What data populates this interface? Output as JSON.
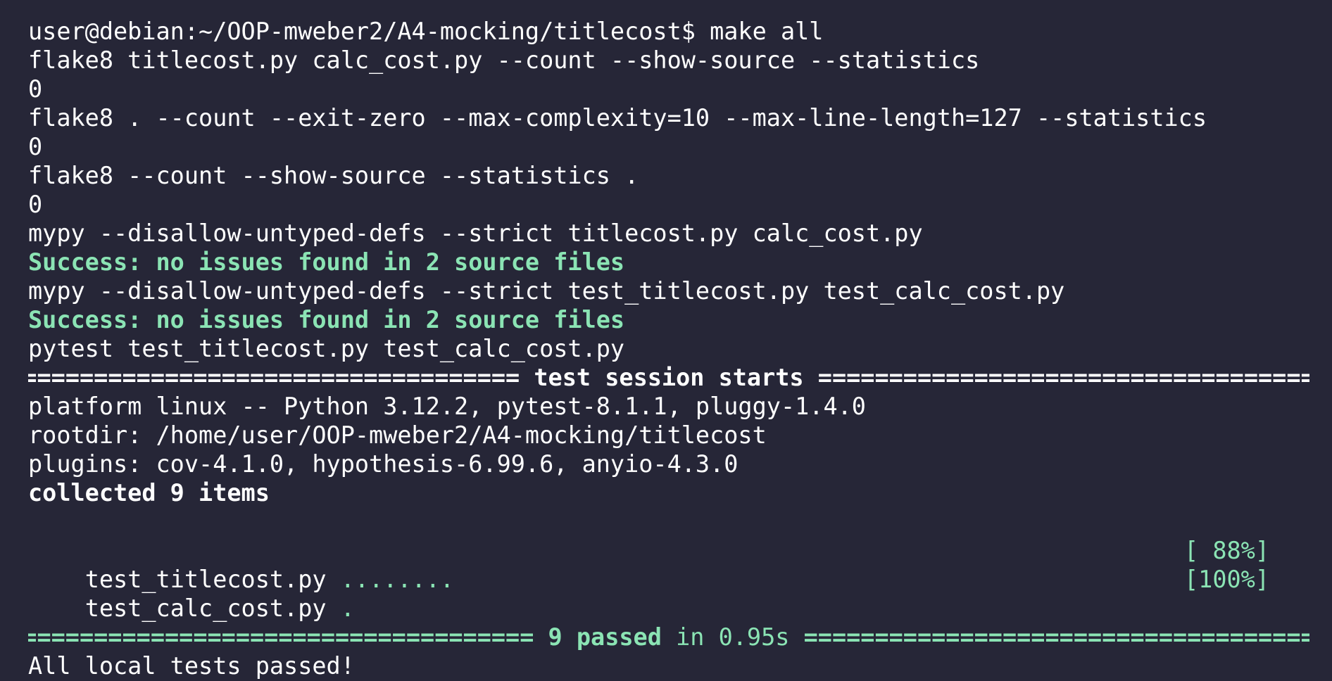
{
  "terminal": {
    "lines": [
      {
        "text": "user@debian:~/OOP-mweber2/A4-mocking/titlecost$ make all"
      },
      {
        "text": "flake8 titlecost.py calc_cost.py --count --show-source --statistics"
      },
      {
        "text": "0"
      },
      {
        "text": "flake8 . --count --exit-zero --max-complexity=10 --max-line-length=127 --statistics"
      },
      {
        "text": "0"
      },
      {
        "text": "flake8 --count --show-source --statistics ."
      },
      {
        "text": "0"
      },
      {
        "text": "mypy --disallow-untyped-defs --strict titlecost.py calc_cost.py"
      },
      {
        "text": "Success: no issues found in 2 source files"
      },
      {
        "text": "mypy --disallow-untyped-defs --strict test_titlecost.py test_calc_cost.py"
      },
      {
        "text": "Success: no issues found in 2 source files"
      },
      {
        "text": "pytest test_titlecost.py test_calc_cost.py"
      }
    ],
    "session_header": "test session starts",
    "platform_line": "platform linux -- Python 3.12.2, pytest-8.1.1, pluggy-1.4.0",
    "rootdir_line": "rootdir: /home/user/OOP-mweber2/A4-mocking/titlecost",
    "plugins_line": "plugins: cov-4.1.0, hypothesis-6.99.6, anyio-4.3.0",
    "collected_line": "collected 9 items",
    "test_files": [
      {
        "name": "test_titlecost.py",
        "dots": "........",
        "percent": "[ 88%]"
      },
      {
        "name": "test_calc_cost.py",
        "dots": ".",
        "percent": "[100%]"
      }
    ],
    "summary": {
      "passed": "9 passed",
      "duration": "in 0.95s"
    },
    "final_line": "All local tests passed!"
  },
  "colors": {
    "background": "#262637",
    "text": "#ffffff",
    "success": "#8be4b4"
  }
}
